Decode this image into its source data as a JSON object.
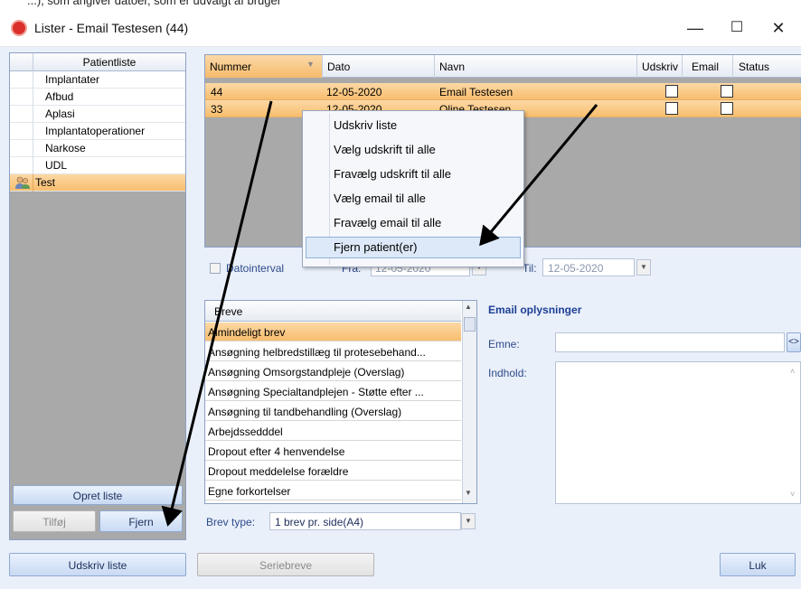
{
  "top_fragment": "...), som angiver datoer, som er udvalgt af bruger",
  "window": {
    "title": "Lister - Email Testesen (44)",
    "controls": {
      "minimize": "—",
      "maximize": "☐",
      "close": "✕"
    }
  },
  "left_panel": {
    "header": "Patientliste",
    "items": [
      {
        "label": "Implantater"
      },
      {
        "label": "Afbud"
      },
      {
        "label": "Aplasi"
      },
      {
        "label": "Implantatoperationer"
      },
      {
        "label": "Narkose"
      },
      {
        "label": "UDL"
      },
      {
        "label": "Test",
        "icon": "users-icon",
        "selected": true
      }
    ],
    "buttons": {
      "create": "Opret liste",
      "add": "Tilføj",
      "remove": "Fjern"
    }
  },
  "patient_grid": {
    "columns": [
      "Nummer",
      "Dato",
      "Navn",
      "Udskriv",
      "Email",
      "Status"
    ],
    "rows": [
      {
        "nummer": "44",
        "dato": "12-05-2020",
        "navn": "Email Testesen",
        "udskriv": false,
        "email": false
      },
      {
        "nummer": "33",
        "dato": "12-05-2020",
        "navn": "Oline Testesen",
        "udskriv": false,
        "email": false
      }
    ]
  },
  "date_filter": {
    "checkbox_label": "Datointerval",
    "from_label": "Fra:",
    "from_value": "12-05-2020",
    "to_label": "Til:",
    "to_value": "12-05-2020"
  },
  "context_menu": {
    "items": [
      "Udskriv liste",
      "Vælg udskrift til alle",
      "Fravælg udskrift til alle",
      "Vælg email til alle",
      "Fravælg email til alle",
      "Fjern patient(er)"
    ],
    "highlighted_index": 5
  },
  "letters": {
    "header": "Breve",
    "items": [
      "Almindeligt brev",
      "Ansøgning helbredstillæg til protesebehand...",
      "Ansøgning Omsorgstandpleje (Overslag)",
      "Ansøgning Specialtandplejen - Støtte efter ...",
      "Ansøgning til tandbehandling (Overslag)",
      "Arbejdssedddel",
      "Dropout efter 4 henvendelse",
      "Dropout meddelelse forældre",
      "Egne forkortelser"
    ],
    "type_label": "Brev type:",
    "type_value": "1 brev pr. side(A4)"
  },
  "email_info": {
    "heading": "Email oplysninger",
    "subject_label": "Emne:",
    "subject_value": "",
    "body_label": "Indhold:",
    "body_value": "",
    "insert_button": "<>"
  },
  "bottom_buttons": {
    "print": "Udskriv liste",
    "serial": "Seriebreve",
    "close": "Luk"
  },
  "colors": {
    "selection": "#f8bd6d",
    "accent": "#1c3f94",
    "panel": "#a9a9a9",
    "background": "#eaf0fa"
  }
}
